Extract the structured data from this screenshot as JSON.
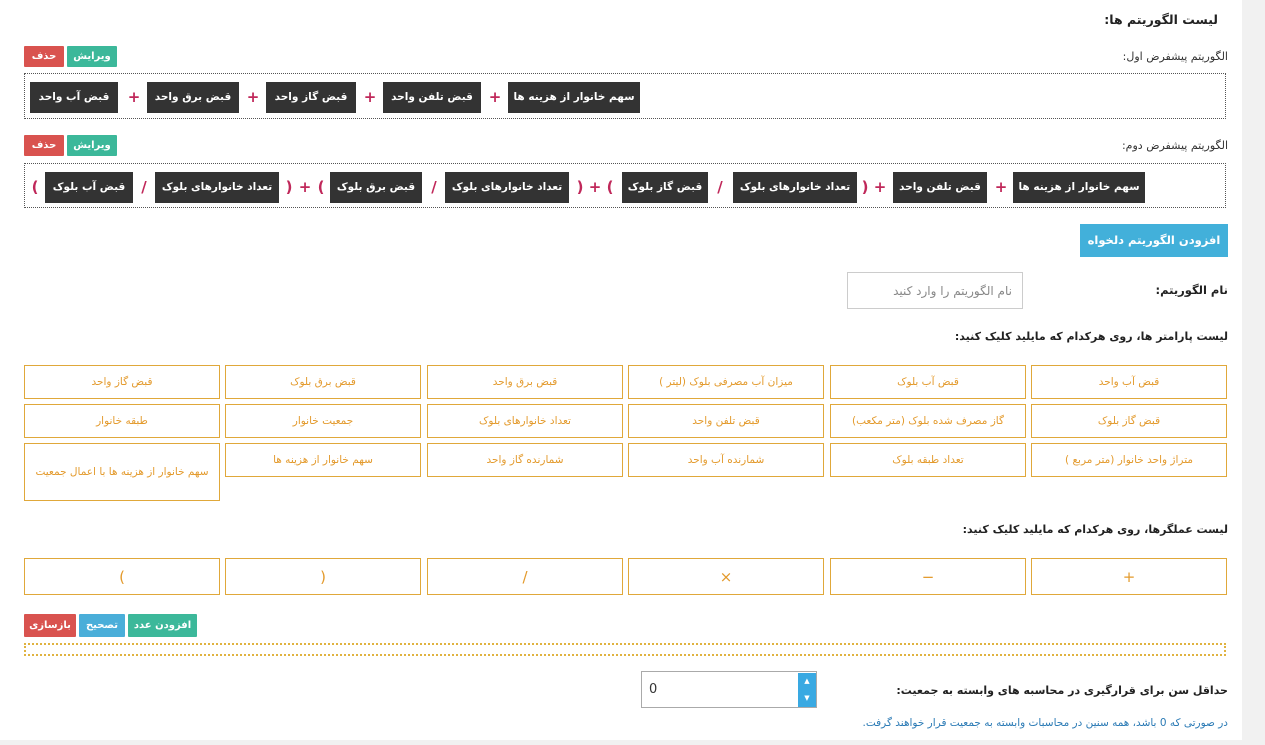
{
  "page_title": "لیست الگوریتم ها:",
  "algorithms": [
    {
      "label": "الگوریتم پیشفرض اول:",
      "edit_label": "ویرایش",
      "delete_label": "حذف",
      "tokens": [
        "سهم خانوار از هزینه ها",
        "+",
        "قبض تلفن واحد",
        "+",
        "قبض گاز واحد",
        "+",
        "قبض برق واحد",
        "+",
        "قبض آب واحد"
      ]
    },
    {
      "label": "الگوریتم پیشفرض دوم:",
      "edit_label": "ویرایش",
      "delete_label": "حذف",
      "tokens": [
        "سهم خانوار از هزینه ها",
        "+",
        "قبض تلفن واحد",
        "+",
        "(",
        "تعداد خانوارهای بلوک",
        "/",
        "قبض گاز بلوک",
        ")",
        "+",
        "(",
        "تعداد خانوارهای بلوک",
        "/",
        "قبض برق بلوک",
        ")",
        "+",
        "(",
        "تعداد خانوارهای بلوک",
        "/",
        "قبض آب بلوک",
        ")"
      ]
    }
  ],
  "add_custom_button": "افزودن الگوریتم دلخواه",
  "name_field": {
    "label": "نام الگوریتم:",
    "placeholder": "نام الگوریتم را وارد کنید"
  },
  "params_label": "لیست پارامتر ها، روی هرکدام که مایلید کلیک کنید:",
  "params": [
    "قبض آب واحد",
    "قبض آب بلوک",
    "میزان آب مصرفی بلوک (لیتر )",
    "قبض برق واحد",
    "قبض برق بلوک",
    "قبض گاز واحد",
    "قبض گاز بلوک",
    "گاز مصرف شده بلوک (متر مکعب)",
    "قبض تلفن واحد",
    "تعداد خانوارهای بلوک",
    "جمعیت خانوار",
    "طبقه خانوار",
    "متراژ واحد خانوار (متر مربع )",
    "تعداد طبقه بلوک",
    "شمارنده آب واحد",
    "شمارنده گاز واحد",
    "سهم خانوار از هزینه ها",
    "سهم خانوار از هزینه ها با اعمال جمعیت"
  ],
  "operators_label": "لیست عملگرها، روی هرکدام که مایلید کلیک کنید:",
  "operators": [
    "+",
    "−",
    "×",
    "/",
    "(",
    ")"
  ],
  "actions": {
    "add_number": "افزودن عدد",
    "correct": "تصحیح",
    "reset": "بازسازی"
  },
  "min_age": {
    "label": "حداقل سن برای قرارگیری در محاسبه های وابسته به جمعیت:",
    "value": "0",
    "note": "در صورتی که 0 باشد، همه سنین در محاسبات وابسته به جمعیت قرار خواهند گرفت."
  }
}
